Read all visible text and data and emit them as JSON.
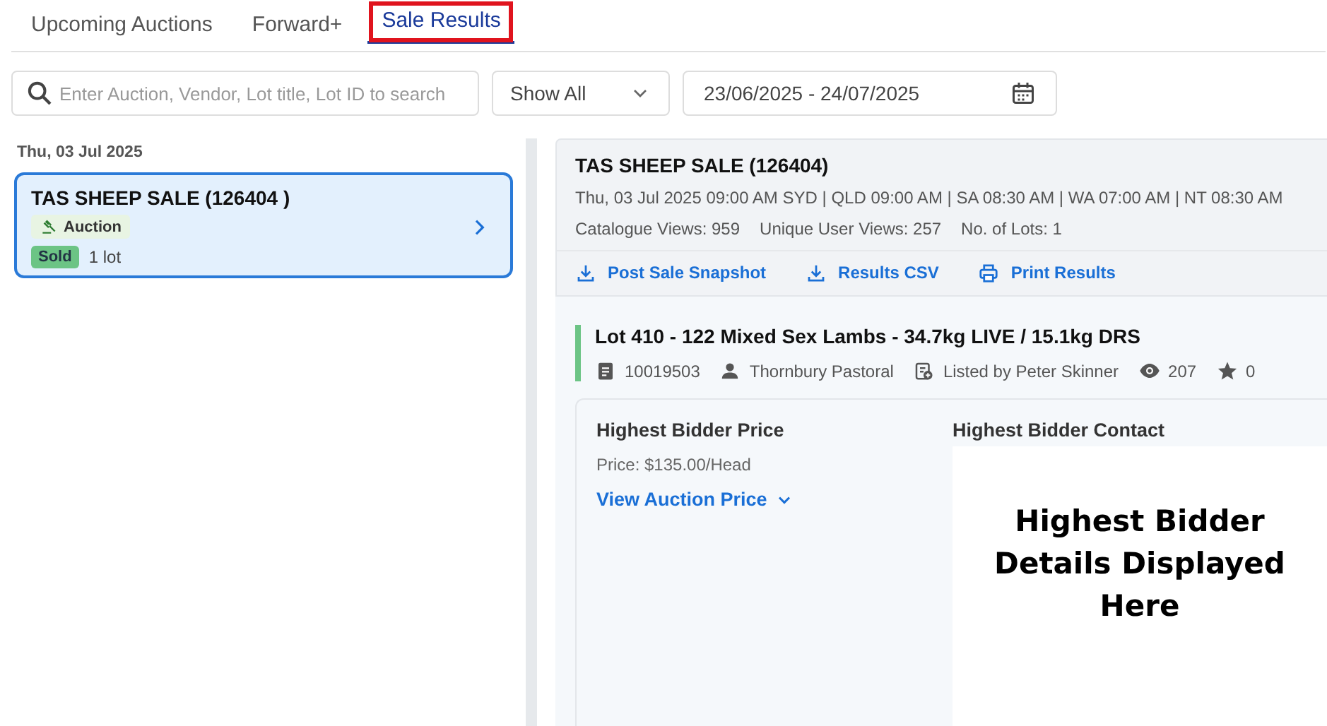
{
  "tabs": [
    {
      "label": "Upcoming Auctions",
      "selected": false,
      "highlighted": false
    },
    {
      "label": "Forward+",
      "selected": false,
      "highlighted": false
    },
    {
      "label": "Sale Results",
      "selected": true,
      "highlighted": true
    }
  ],
  "filters": {
    "search": {
      "placeholder": "Enter Auction, Vendor, Lot title, Lot ID to search"
    },
    "show": {
      "value": "Show All"
    },
    "date_range": {
      "value": "23/06/2025 - 24/07/2025"
    }
  },
  "sale_list": {
    "date": "Thu, 03 Jul 2025",
    "sales": [
      {
        "title": "TAS SHEEP SALE (126404 )",
        "type": "Auction",
        "status": "Sold",
        "lots": "1 lot",
        "selected": true
      }
    ]
  },
  "sale_detail": {
    "title": "TAS SHEEP SALE (126404)",
    "times": "Thu, 03 Jul 2025 09:00 AM SYD | QLD 09:00 AM | SA 08:30 AM | WA 07:00 AM | NT 08:30 AM",
    "stats": [
      "Catalogue Views: 959",
      "Unique User Views: 257",
      "No. of Lots: 1"
    ],
    "actions": [
      {
        "kind": "download",
        "label": "Post Sale Snapshot"
      },
      {
        "kind": "download",
        "label": "Results CSV"
      },
      {
        "kind": "print",
        "label": "Print Results"
      }
    ],
    "lot": {
      "title": "Lot 410 - 122 Mixed Sex Lambs - 34.7kg LIVE / 15.1kg DRS",
      "meta": [
        {
          "kind": "id",
          "text": "10019503"
        },
        {
          "kind": "vendor",
          "text": "Thornbury Pastoral"
        },
        {
          "kind": "listed",
          "text": "Listed by Peter Skinner"
        },
        {
          "kind": "views",
          "text": "207"
        },
        {
          "kind": "stars",
          "text": "0"
        }
      ]
    },
    "price": {
      "heading": "Highest Bidder Price",
      "price": "Price: $135.00/Head",
      "link": "View Auction Price"
    },
    "contact": {
      "heading": "Highest Bidder Contact",
      "note": "Highest Bidder Details Displayed Here"
    }
  }
}
